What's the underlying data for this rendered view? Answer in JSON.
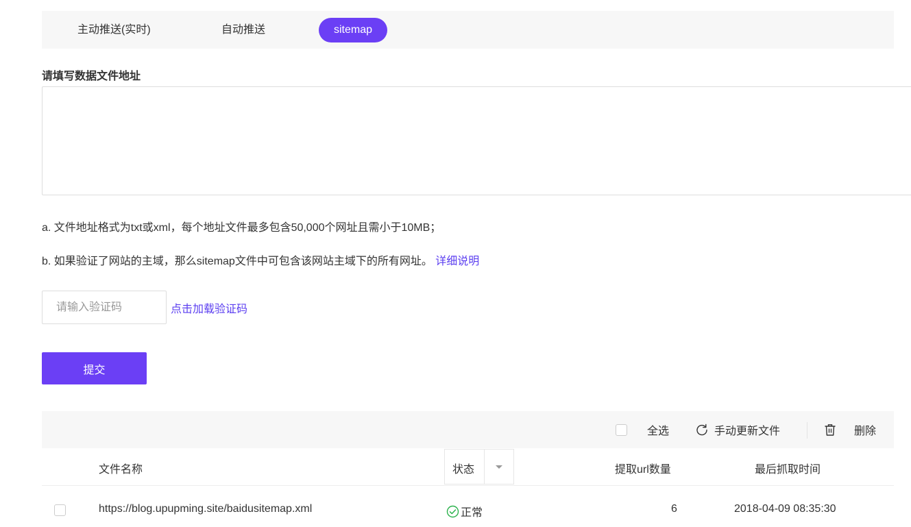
{
  "tabs": [
    {
      "label": "主动推送(实时)",
      "active": false
    },
    {
      "label": "自动推送",
      "active": false
    },
    {
      "label": "sitemap",
      "active": true
    }
  ],
  "form": {
    "title": "请填写数据文件地址",
    "textarea_value": "",
    "note_a": "a. 文件地址格式为txt或xml，每个地址文件最多包含50,000个网址且需小于10MB；",
    "note_b": "b. 如果验证了网站的主域，那么sitemap文件中可包含该网站主域下的所有网址。",
    "note_b_link": "详细说明",
    "captcha_placeholder": "请输入验证码",
    "captcha_link": "点击加载验证码",
    "submit_label": "提交"
  },
  "toolbar": {
    "select_all": "全选",
    "refresh": "手动更新文件",
    "delete": "删除"
  },
  "table": {
    "columns": {
      "name": "文件名称",
      "status": "状态",
      "count": "提取url数量",
      "time": "最后抓取时间"
    },
    "rows": [
      {
        "url": "https://blog.upupming.site/baidusitemap.xml",
        "status": "正常",
        "count": "6",
        "time": "2018-04-09 08:35:30"
      }
    ]
  },
  "colors": {
    "accent": "#6b3ff5",
    "link": "#5b3ef0",
    "success": "#2bb24c"
  },
  "icons": {
    "refresh": "refresh-icon",
    "delete": "trash-icon",
    "status_ok": "check-circle-icon",
    "dropdown": "caret-down-icon"
  }
}
